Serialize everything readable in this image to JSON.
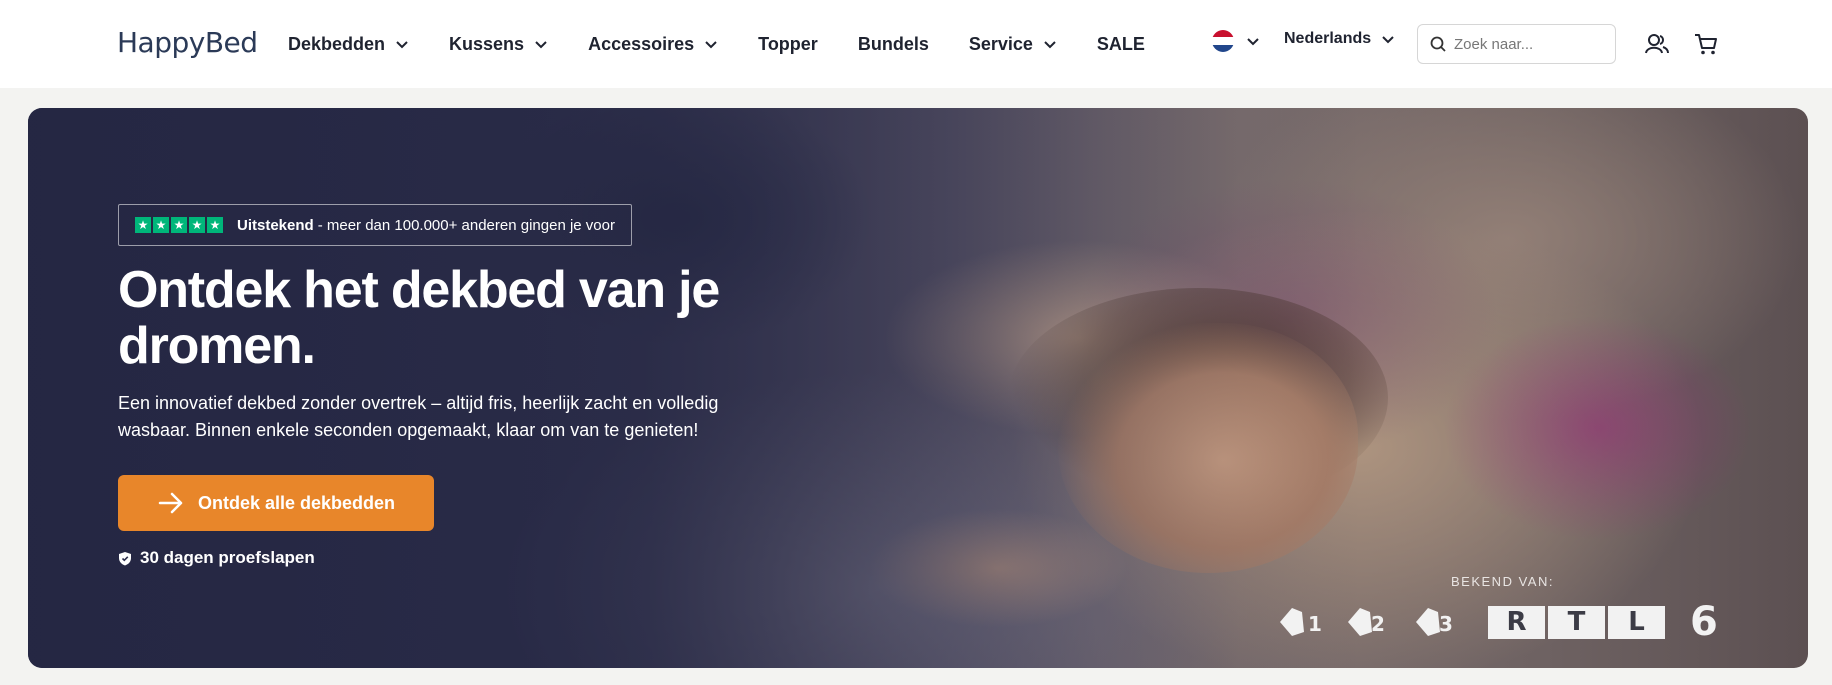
{
  "header": {
    "logo_text": "HappyBed",
    "nav": [
      {
        "label": "Dekbedden",
        "has_dropdown": true
      },
      {
        "label": "Kussens",
        "has_dropdown": true
      },
      {
        "label": "Accessoires",
        "has_dropdown": true
      },
      {
        "label": "Topper",
        "has_dropdown": false
      },
      {
        "label": "Bundels",
        "has_dropdown": false
      },
      {
        "label": "Service",
        "has_dropdown": true
      },
      {
        "label": "SALE",
        "has_dropdown": false
      }
    ],
    "country_flag": "netherlands-flag",
    "language": "Nederlands",
    "search_placeholder": "Zoek naar...",
    "icons": [
      "user-icon",
      "cart-icon"
    ]
  },
  "hero": {
    "trust_rating": "Uitstekend",
    "trust_text": "- meer dan 100.000+ anderen gingen je voor",
    "title": "Ontdek het dekbed van je dromen.",
    "subtitle": "Een innovatief dekbed zonder overtrek – altijd fris, heerlijk zacht en volledig wasbaar. Binnen enkele seconden opgemaakt, klaar om van te genieten!",
    "cta_label": "Ontdek alle dekbedden",
    "trial_text": "30 dagen proefslapen",
    "known_from_label": "BEKEND VAN:",
    "brands": {
      "npo": [
        "1",
        "2",
        "3"
      ],
      "rtl": [
        "R",
        "T",
        "L"
      ],
      "six": "6"
    }
  },
  "colors": {
    "accent_orange": "#e8862a",
    "trustpilot_green": "#00b67a",
    "hero_dark": "#2d2f4d"
  }
}
